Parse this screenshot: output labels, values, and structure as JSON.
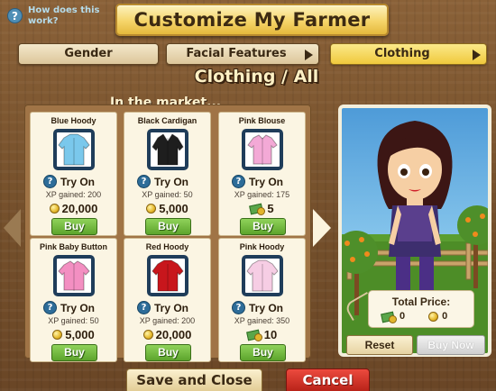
{
  "help": {
    "text": "How does this work?"
  },
  "title": "Customize My Farmer",
  "tabs": [
    {
      "label": "Gender",
      "active": false,
      "has_arrow": false
    },
    {
      "label": "Facial Features",
      "active": false,
      "has_arrow": true
    },
    {
      "label": "Clothing",
      "active": true,
      "has_arrow": true
    }
  ],
  "section_title": "Clothing / All",
  "market_label": "In the market...",
  "items": [
    {
      "name": "Blue Hoody",
      "try_label": "Try On",
      "xp": "XP gained: 200",
      "price": "20,000",
      "currency": "coins",
      "buy_label": "Buy",
      "color": "#7ac8ec",
      "icon": "hoody-icon"
    },
    {
      "name": "Black Cardigan",
      "try_label": "Try On",
      "xp": "XP gained: 50",
      "price": "5,000",
      "currency": "coins",
      "buy_label": "Buy",
      "color": "#1e1e1e",
      "icon": "cardigan-icon"
    },
    {
      "name": "Pink Blouse",
      "try_label": "Try On",
      "xp": "XP gained: 175",
      "price": "5",
      "currency": "cash",
      "buy_label": "Buy",
      "color": "#f3a9d6",
      "icon": "blouse-icon"
    },
    {
      "name": "Pink Baby Button",
      "try_label": "Try On",
      "xp": "XP gained: 50",
      "price": "5,000",
      "currency": "coins",
      "buy_label": "Buy",
      "color": "#f38fc2",
      "icon": "shirt-icon"
    },
    {
      "name": "Red Hoody",
      "try_label": "Try On",
      "xp": "XP gained: 200",
      "price": "20,000",
      "currency": "coins",
      "buy_label": "Buy",
      "color": "#c8161c",
      "icon": "hoody-icon"
    },
    {
      "name": "Pink Hoody",
      "try_label": "Try On",
      "xp": "XP gained: 350",
      "price": "10",
      "currency": "cash",
      "buy_label": "Buy",
      "color": "#f6cde4",
      "icon": "hoody-icon"
    }
  ],
  "preview": {
    "total_label": "Total Price:",
    "total_cash": "0",
    "total_coins": "0",
    "reset_label": "Reset",
    "buy_now_label": "Buy Now"
  },
  "footer": {
    "save_label": "Save and Close",
    "cancel_label": "Cancel"
  }
}
